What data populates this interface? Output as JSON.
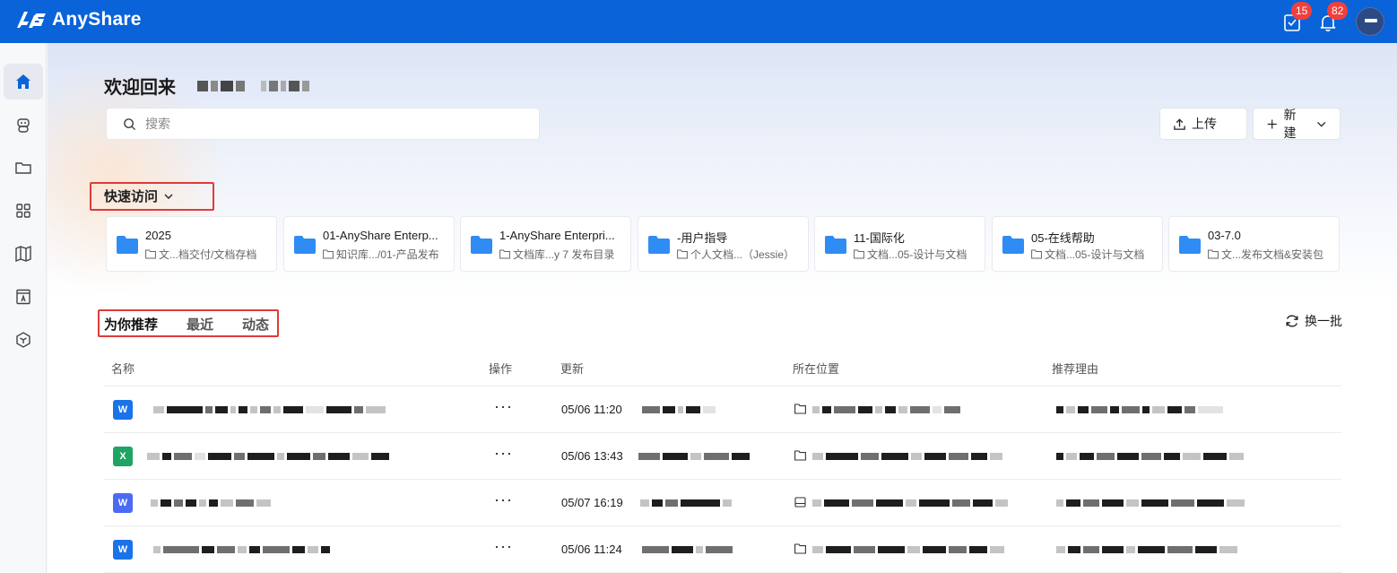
{
  "app": {
    "brand": "AnyShare"
  },
  "topbar": {
    "tasks_badge": "15",
    "notifications_badge": "82"
  },
  "sidebar": {
    "items": [
      {
        "name": "home",
        "active": true
      },
      {
        "name": "assistant",
        "active": false
      },
      {
        "name": "documents",
        "active": false
      },
      {
        "name": "apps",
        "active": false
      },
      {
        "name": "map",
        "active": false
      },
      {
        "name": "knowledge",
        "active": false
      },
      {
        "name": "settings",
        "active": false
      }
    ]
  },
  "main": {
    "welcome": "欢迎回来",
    "search_placeholder": "搜索",
    "upload_label": "上传",
    "new_label": "新建",
    "quick_access": {
      "title": "快速访问",
      "items": [
        {
          "name": "2025",
          "path": "文...档交付/文档存档"
        },
        {
          "name": "01-AnyShare Enterp...",
          "path": "知识库.../01-产品发布"
        },
        {
          "name": "1-AnyShare Enterpri...",
          "path": "文档库...y 7 发布目录"
        },
        {
          "name": "-用户指导",
          "path": "个人文档...（Jessie）"
        },
        {
          "name": "11-国际化",
          "path": "文档...05-设计与文档"
        },
        {
          "name": "05-在线帮助",
          "path": "文档...05-设计与文档"
        },
        {
          "name": "03-7.0",
          "path": "文...发布文档&安装包"
        }
      ]
    },
    "tabs": [
      {
        "label": "为你推荐",
        "active": true
      },
      {
        "label": "最近",
        "active": false
      },
      {
        "label": "动态",
        "active": false
      }
    ],
    "refresh_label": "换一批",
    "table": {
      "columns": [
        "名称",
        "操作",
        "更新",
        "所在位置",
        "推荐理由"
      ],
      "rows": [
        {
          "type": "word",
          "icon_text": "W",
          "more": "···",
          "updated": "05/06 11:20",
          "loc_type": "folder"
        },
        {
          "type": "excel",
          "icon_text": "X",
          "more": "···",
          "updated": "05/06 13:43",
          "loc_type": "folder"
        },
        {
          "type": "wps",
          "icon_text": "W",
          "more": "···",
          "updated": "05/07 16:19",
          "loc_type": "library"
        },
        {
          "type": "word",
          "icon_text": "W",
          "more": "···",
          "updated": "05/06 11:24",
          "loc_type": "folder"
        }
      ]
    }
  },
  "colors": {
    "topbar": "#0a63d8",
    "folder": "#2f8cf4",
    "badge": "#f1403c",
    "highlight_box": "#e03a3a"
  }
}
